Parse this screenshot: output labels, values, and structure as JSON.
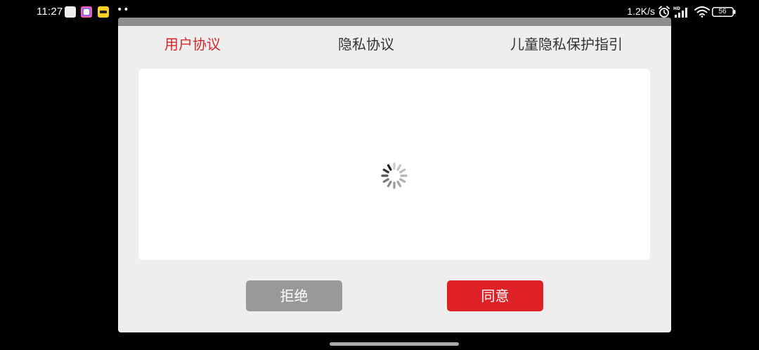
{
  "status_bar": {
    "time": "11:27",
    "more_dots": "••",
    "net_speed": "1.2K/s",
    "battery_level": "56",
    "icons": [
      "notification-square-icon",
      "app-notification-icon",
      "app-notification-icon",
      "alarm-icon",
      "hd-signal-icon",
      "wifi-icon",
      "battery-icon"
    ]
  },
  "dialog": {
    "tabs": [
      {
        "label": "用户协议",
        "active": true
      },
      {
        "label": "隐私协议",
        "active": false
      },
      {
        "label": "儿童隐私保护指引",
        "active": false
      }
    ],
    "content": {
      "state": "loading",
      "spinner_icon": "loading-spinner-icon"
    },
    "buttons": {
      "reject_label": "拒绝",
      "agree_label": "同意"
    }
  },
  "colors": {
    "accent": "#df2027",
    "active_tab": "#d7262b",
    "reject_button": "#999999",
    "dialog_bg": "#eeeeee",
    "dialog_topbar": "#8e8e8e",
    "screen_bg": "#000000"
  }
}
